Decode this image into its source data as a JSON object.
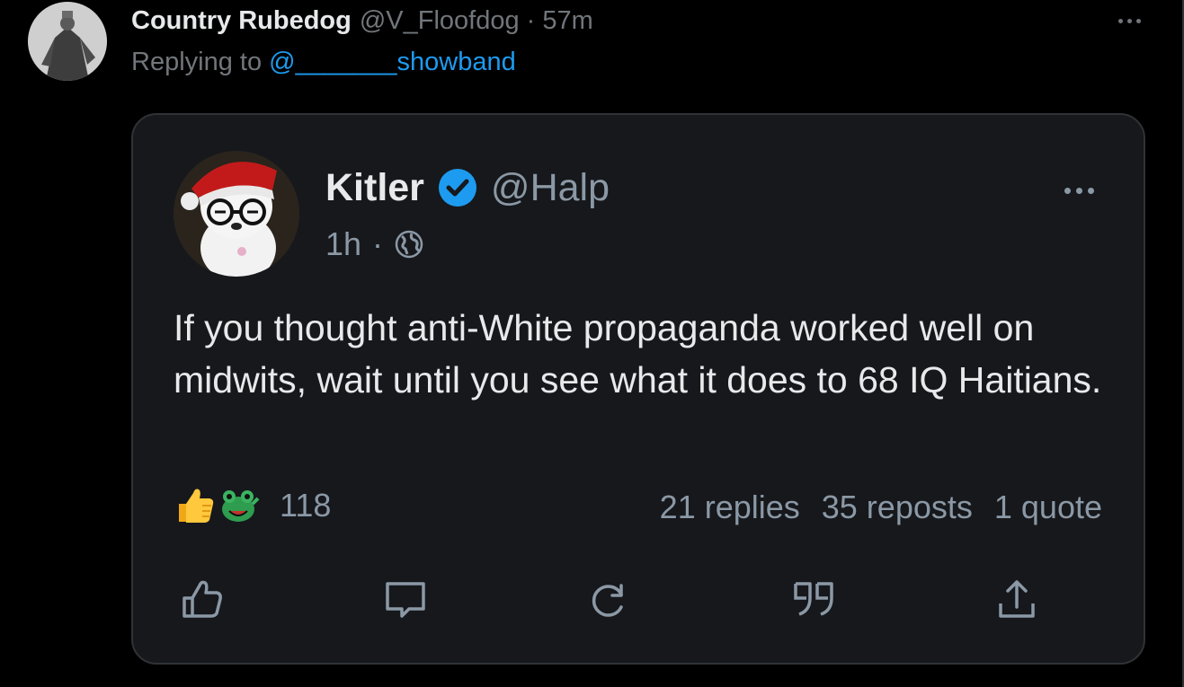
{
  "tweet": {
    "display_name": "Country Rubedog",
    "meta": "@V_Floofdog · 57m",
    "reply_prefix": "Replying to ",
    "reply_target": "@_______showband",
    "more_icon": "more-horizontal-icon"
  },
  "quoted": {
    "display_name": "Kitler",
    "verified_icon": "verified-badge-icon",
    "handle": "@Halp",
    "time": "1h",
    "separator": "·",
    "audience_icon": "globe-icon",
    "body": "If you thought anti-White propaganda worked well on midwits, wait until you see what it does to 68 IQ Haitians.",
    "reactions": {
      "icons": [
        "thumbs-up-emoji",
        "frog-emoji"
      ],
      "count": "118"
    },
    "stats": {
      "replies": "21 replies",
      "reposts": "35 reposts",
      "quotes": "1 quote"
    },
    "actions": [
      {
        "name": "like-button",
        "icon": "thumbs-up-icon"
      },
      {
        "name": "reply-button",
        "icon": "comment-icon"
      },
      {
        "name": "repost-button",
        "icon": "refresh-icon"
      },
      {
        "name": "quote-button",
        "icon": "quote-icon"
      },
      {
        "name": "share-button",
        "icon": "share-icon"
      }
    ]
  },
  "colors": {
    "background": "#000000",
    "card": "#16181c",
    "border": "#2f3336",
    "text": "#e7e9ea",
    "muted": "#71767b",
    "link": "#1d9bf0",
    "verified": "#1d9bf0"
  }
}
